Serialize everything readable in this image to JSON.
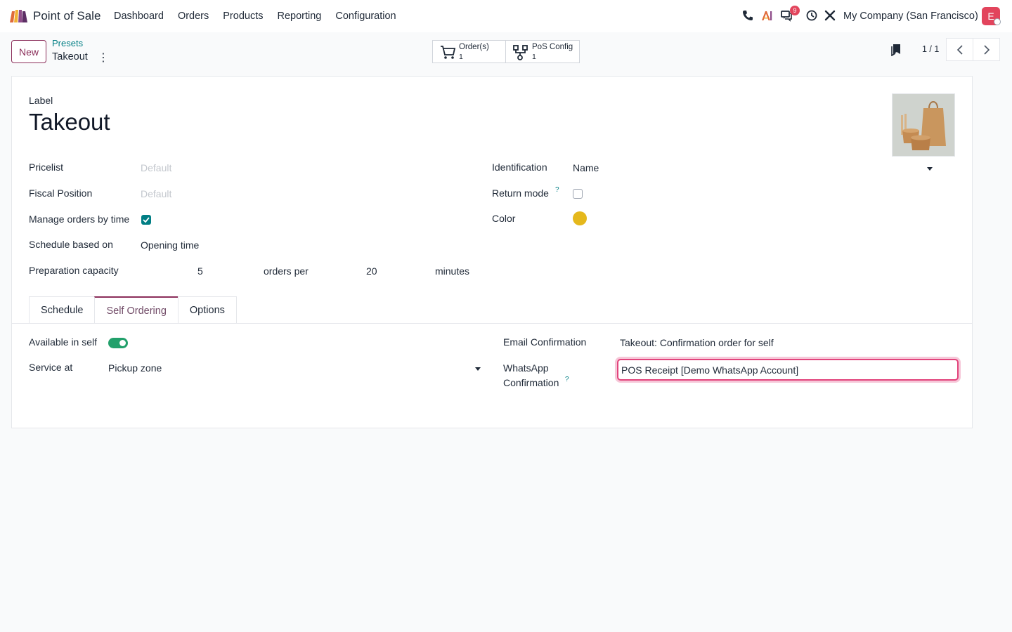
{
  "navbar": {
    "app_name": "Point of Sale",
    "menu": [
      "Dashboard",
      "Orders",
      "Products",
      "Reporting",
      "Configuration"
    ],
    "company": "My Company (San Francisco)",
    "avatar_letter": "E",
    "messages_badge": "9",
    "tray_icons": [
      "phone-icon",
      "ai-icon",
      "chat-icon",
      "clock-icon",
      "tools-icon"
    ]
  },
  "control": {
    "new_label": "New",
    "breadcrumb_parent": "Presets",
    "breadcrumb_current": "Takeout",
    "smart_buttons": [
      {
        "label": "Order(s)",
        "count": "1",
        "icon": "cart-icon"
      },
      {
        "label": "PoS Config",
        "count": "1",
        "icon": "config-icon"
      }
    ],
    "pager": "1 / 1"
  },
  "form": {
    "label_caption": "Label",
    "title": "Takeout",
    "left": {
      "pricelist_label": "Pricelist",
      "pricelist_placeholder": "Default",
      "fiscal_label": "Fiscal Position",
      "fiscal_placeholder": "Default",
      "manage_label": "Manage orders by time",
      "manage_checked": true,
      "schedule_label": "Schedule based on",
      "schedule_value": "Opening time",
      "capacity_label": "Preparation capacity",
      "capacity_orders": "5",
      "capacity_orders_per": "orders per",
      "capacity_minutes_value": "20",
      "capacity_minutes_unit": "minutes"
    },
    "right": {
      "identification_label": "Identification",
      "identification_value": "Name",
      "return_label": "Return mode",
      "return_help": "?",
      "return_checked": false,
      "color_label": "Color",
      "color_value": "#e5b81c"
    },
    "tabs": [
      "Schedule",
      "Self Ordering",
      "Options"
    ],
    "active_tab": "Self Ordering",
    "self_ordering": {
      "available_label": "Available in self",
      "available_on": true,
      "service_label": "Service at",
      "service_value": "Pickup zone",
      "email_label": "Email Confirmation",
      "email_value": "Takeout: Confirmation order for self",
      "whatsapp_label_1": "WhatsApp",
      "whatsapp_label_2": "Confirmation",
      "whatsapp_help": "?",
      "whatsapp_value": "POS Receipt [Demo WhatsApp Account]"
    }
  }
}
